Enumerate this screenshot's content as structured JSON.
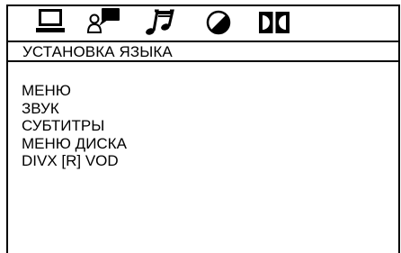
{
  "toolbar": {
    "icons": [
      "monitor-icon",
      "user-speech-icon",
      "music-note-icon",
      "disc-icon",
      "dolby-icon"
    ]
  },
  "page": {
    "title": "УСТАНОВКА ЯЗЫКА"
  },
  "menu": {
    "items": [
      {
        "label": "МЕНЮ"
      },
      {
        "label": "ЗВУК"
      },
      {
        "label": "СУБТИТРЫ"
      },
      {
        "label": "МЕНЮ ДИСКА"
      },
      {
        "label": "DIVX [R] VOD"
      }
    ]
  },
  "colors": {
    "background": "#ffffff",
    "foreground": "#000000"
  }
}
